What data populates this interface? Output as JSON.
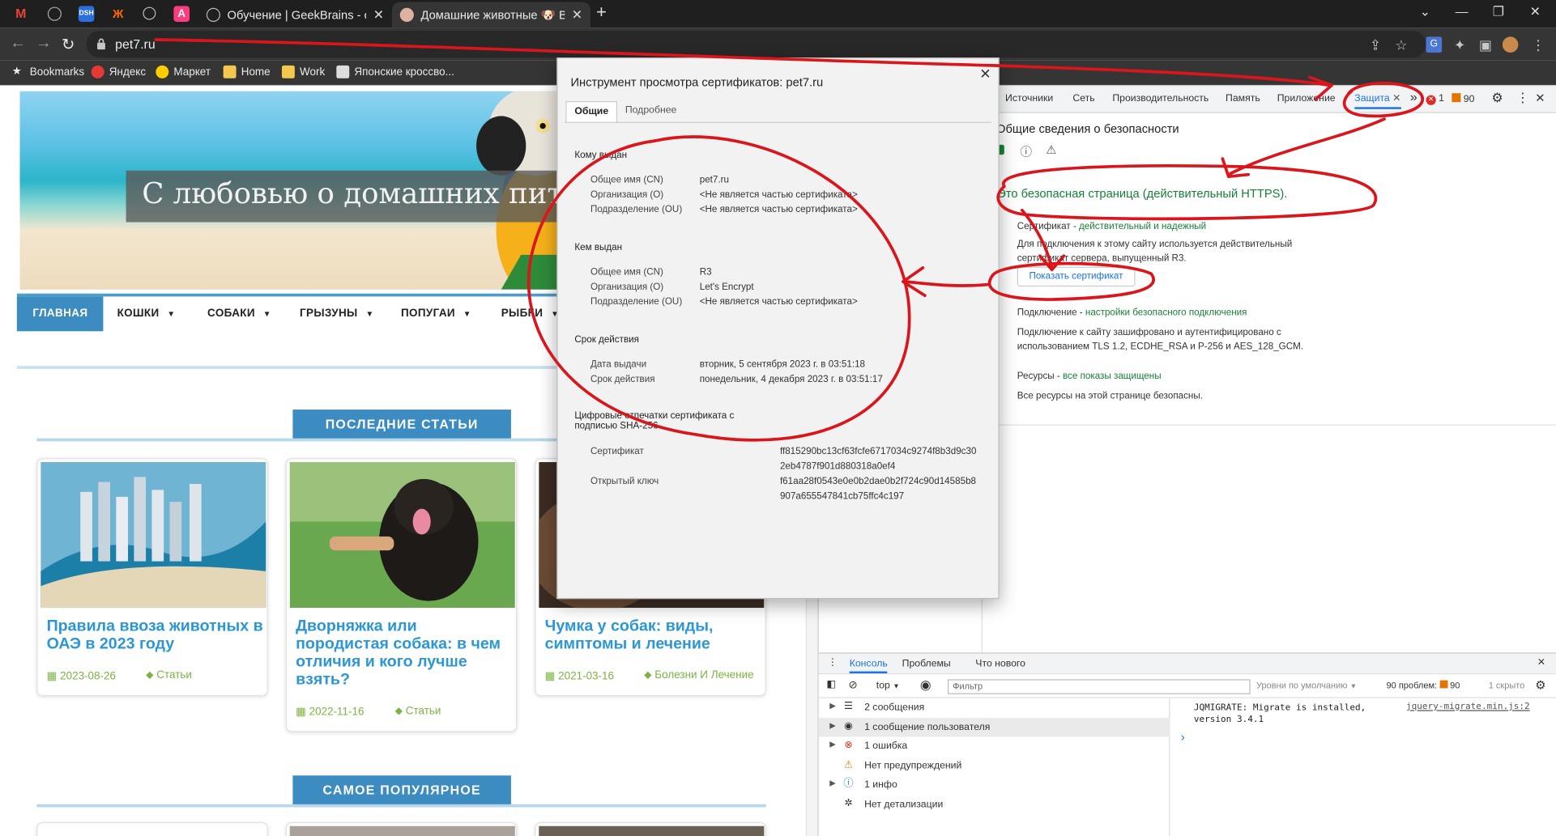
{
  "browser": {
    "tabs": [
      {
        "label": "Обучение | GeekBrains - образо"
      },
      {
        "label": "Домашние животные 🐶 Все о"
      }
    ],
    "new_tab": "+",
    "url": "pet7.ru",
    "bookmarks": [
      "Bookmarks",
      "Яндекс",
      "Маркет",
      "Home",
      "Work",
      "Японские кроссво..."
    ]
  },
  "site": {
    "banner": "С любовью о домашних пит",
    "menu": [
      {
        "label": "ГЛАВНАЯ",
        "caret": false
      },
      {
        "label": "КОШКИ",
        "caret": true
      },
      {
        "label": "СОБАКИ",
        "caret": true
      },
      {
        "label": "ГРЫЗУНЫ",
        "caret": true
      },
      {
        "label": "ПОПУГАИ",
        "caret": true
      },
      {
        "label": "РЫБКИ",
        "caret": true
      }
    ],
    "latest_heading": "ПОСЛЕДНИЕ СТАТЬИ",
    "popular_heading": "САМОЕ ПОПУЛЯРНОЕ",
    "cards": [
      {
        "title": "Правила ввоза животных в ОАЭ в 2023 году",
        "date": "2023-08-26",
        "category": "Статьи"
      },
      {
        "title": "Дворняжка или породистая собака: в чем отличия и кого лучше взять?",
        "date": "2022-11-16",
        "category": "Статьи"
      },
      {
        "title": "Чумка у собак: виды, симптомы и лечение",
        "date": "2021-03-16",
        "category": "Болезни И Лечение"
      }
    ]
  },
  "cert": {
    "title": "Инструмент просмотра сертификатов: pet7.ru",
    "tabs": [
      "Общие",
      "Подробнее"
    ],
    "issued_to": {
      "heading": "Кому выдан",
      "rows": [
        {
          "k": "Общее имя (CN)",
          "v": "pet7.ru"
        },
        {
          "k": "Организация (O)",
          "v": "<Не является частью сертификата>"
        },
        {
          "k": "Подразделение (OU)",
          "v": "<Не является частью сертификата>"
        }
      ]
    },
    "issued_by": {
      "heading": "Кем выдан",
      "rows": [
        {
          "k": "Общее имя (CN)",
          "v": "R3"
        },
        {
          "k": "Организация (O)",
          "v": "Let's Encrypt"
        },
        {
          "k": "Подразделение (OU)",
          "v": "<Не является частью сертификата>"
        }
      ]
    },
    "validity": {
      "heading": "Срок действия",
      "rows": [
        {
          "k": "Дата выдачи",
          "v": "вторник, 5 сентября 2023 г. в 03:51:18"
        },
        {
          "k": "Срок действия",
          "v": "понедельник, 4 декабря 2023 г. в 03:51:17"
        }
      ]
    },
    "fingerprints": {
      "heading_line1": "Цифровые отпечатки сертификата с",
      "heading_line2": "подписью SHA-256",
      "cert_label": "Сертификат",
      "cert_line1": "ff815290bc13cf63fcfe6717034c9274f8b3d9c30",
      "cert_line2": "2eb4787f901d880318a0ef4",
      "key_label": "Открытый ключ",
      "key_line1": "f61aa28f0543e0e0b2dae0b2f724c90d14585b8",
      "key_line2": "907a655547841cb75ffc4c197"
    }
  },
  "devtools": {
    "tabs": [
      "Источники",
      "Сеть",
      "Производительность",
      "Память",
      "Приложение",
      "Защита"
    ],
    "more": "»",
    "error_count": "1",
    "warn_count": "90",
    "security": {
      "title": "Общие сведения о безопасности",
      "summary": "Это безопасная страница (действительный HTTPS).",
      "cert_label": "Сертификат - ",
      "cert_status": "действительный и надежный",
      "cert_desc1": "Для подключения к этому сайту используется действительный",
      "cert_desc2": "сертификат сервера, выпущенный R3.",
      "show_cert": "Показать сертификат",
      "conn_label": "Подключение - ",
      "conn_status": "настройки безопасного подключения",
      "conn_desc1": "Подключение к сайту зашифровано и аутентифицировано с",
      "conn_desc2": "использованием TLS 1.2, ECDHE_RSA и P-256 и AES_128_GCM.",
      "res_label": "Ресурсы - ",
      "res_status": "все показы защищены",
      "res_desc": "Все ресурсы на этой странице безопасны."
    },
    "drawer_tabs": [
      "Консоль",
      "Проблемы",
      "Что нового"
    ],
    "console": {
      "context": "top",
      "filter_placeholder": "Фильтр",
      "levels": "Уровни по умолчанию",
      "problems": "90 проблем:",
      "problems_count": "90",
      "hidden": "1 скрыто",
      "sidebar": [
        {
          "icon": "list-icon",
          "text": "2 сообщения",
          "arrow": true
        },
        {
          "icon": "user-icon",
          "text": "1 сообщение пользователя",
          "arrow": true
        },
        {
          "icon": "error-icon",
          "text": "1 ошибка",
          "arrow": true
        },
        {
          "icon": "warning-icon",
          "text": "Нет предупреждений",
          "arrow": false
        },
        {
          "icon": "info-icon",
          "text": "1 инфо",
          "arrow": true
        },
        {
          "icon": "verbose-icon",
          "text": "Нет детализации",
          "arrow": false
        }
      ],
      "message_line1": "JQMIGRATE: Migrate is installed,",
      "message_line2": "version 3.4.1",
      "message_source": "jquery-migrate.min.js:2",
      "prompt": "›"
    }
  }
}
